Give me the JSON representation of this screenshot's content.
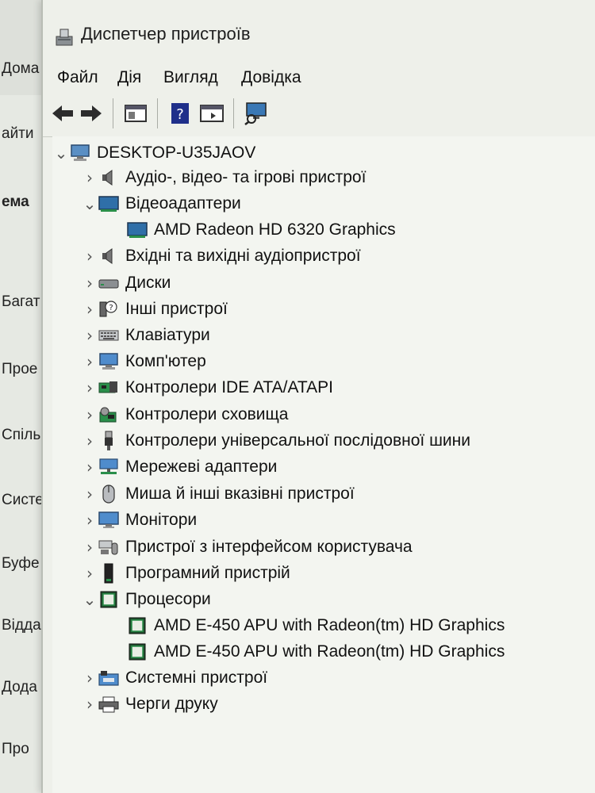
{
  "background_window": {
    "items": [
      "Дома",
      "айти",
      "ема",
      "Багат",
      "Прое",
      "Спіль",
      "Систе",
      "Буфе",
      "Відда",
      "Дода",
      "Про"
    ]
  },
  "window": {
    "title": "Диспетчер пристроїв"
  },
  "menu": {
    "file": "Файл",
    "action": "Дія",
    "view": "Вигляд",
    "help": "Довідка"
  },
  "toolbar": {
    "icons": [
      "back-arrow-icon",
      "forward-arrow-icon",
      "properties-icon",
      "help-icon",
      "update-driver-icon",
      "scan-hardware-icon"
    ]
  },
  "tree": {
    "root": "DESKTOP-U35JAOV",
    "categories": [
      {
        "label": "Аудіо-, відео- та ігрові пристрої",
        "icon": "speaker-icon",
        "expanded": false
      },
      {
        "label": "Відеоадаптери",
        "icon": "display-adapter-icon",
        "expanded": true,
        "children": [
          "AMD Radeon HD 6320 Graphics"
        ]
      },
      {
        "label": "Вхідні та вихідні аудіопристрої",
        "icon": "speaker-icon",
        "expanded": false
      },
      {
        "label": "Диски",
        "icon": "disk-drive-icon",
        "expanded": false
      },
      {
        "label": "Інші пристрої",
        "icon": "unknown-device-icon",
        "expanded": false
      },
      {
        "label": "Клавіатури",
        "icon": "keyboard-icon",
        "expanded": false
      },
      {
        "label": "Комп'ютер",
        "icon": "computer-icon",
        "expanded": false
      },
      {
        "label": "Контролери IDE ATA/ATAPI",
        "icon": "ide-controller-icon",
        "expanded": false
      },
      {
        "label": "Контролери сховища",
        "icon": "storage-controller-icon",
        "expanded": false
      },
      {
        "label": "Контролери універсальної послідовної шини",
        "icon": "usb-icon",
        "expanded": false
      },
      {
        "label": "Мережеві адаптери",
        "icon": "network-adapter-icon",
        "expanded": false
      },
      {
        "label": "Миша й інші вказівні пристрої",
        "icon": "mouse-icon",
        "expanded": false
      },
      {
        "label": "Монітори",
        "icon": "monitor-icon",
        "expanded": false
      },
      {
        "label": "Пристрої з інтерфейсом користувача",
        "icon": "hid-icon",
        "expanded": false
      },
      {
        "label": "Програмний пристрій",
        "icon": "software-device-icon",
        "expanded": false
      },
      {
        "label": "Процесори",
        "icon": "processor-icon",
        "expanded": true,
        "children": [
          "AMD E-450 APU with Radeon(tm) HD Graphics",
          "AMD E-450 APU with Radeon(tm) HD Graphics"
        ]
      },
      {
        "label": "Системні пристрої",
        "icon": "system-devices-icon",
        "expanded": false
      },
      {
        "label": "Черги друку",
        "icon": "printer-icon",
        "expanded": false
      }
    ]
  }
}
